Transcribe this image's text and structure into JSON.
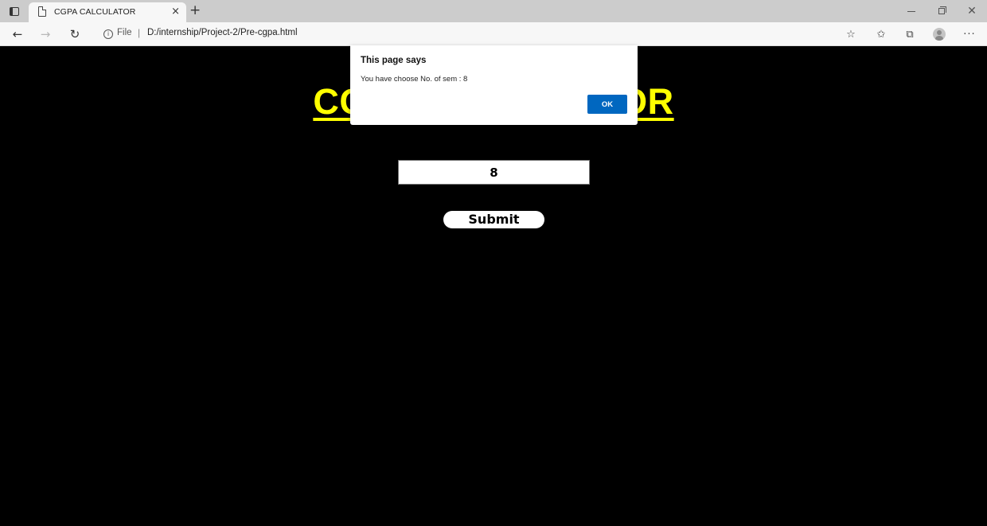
{
  "browser": {
    "tab": {
      "title": "CGPA CALCULATOR",
      "close_glyph": "×",
      "new_tab_glyph": "+"
    },
    "window_controls": {
      "close_glyph": "✕"
    },
    "toolbar": {
      "back_glyph": "←",
      "forward_glyph": "→",
      "refresh_glyph": "↻",
      "info_glyph": "i",
      "address_scheme": "File",
      "address_separator": "|",
      "address_url": "D:/internship/Project-2/Pre-cgpa.html",
      "favorites_add_glyph": "☆",
      "favorites_glyph": "✩",
      "collections_glyph": "⧉",
      "more_glyph": "···"
    }
  },
  "page": {
    "title": "CGPA CALCULATOR",
    "semester_input_value": "8",
    "submit_label": "Submit"
  },
  "alert": {
    "title": "This page says",
    "message": "You have choose No. of sem : 8",
    "ok_label": "OK"
  },
  "colors": {
    "page_background": "#000000",
    "title": "#ffff00",
    "ok_button": "#0067c0"
  }
}
